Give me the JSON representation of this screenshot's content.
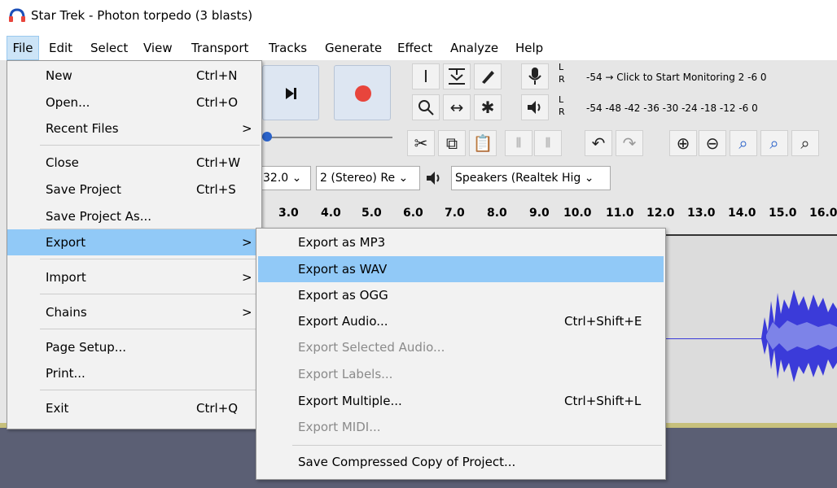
{
  "window": {
    "title": "Star Trek - Photon torpedo (3 blasts)"
  },
  "menubar": [
    {
      "label": "File"
    },
    {
      "label": "Edit"
    },
    {
      "label": "Select"
    },
    {
      "label": "View"
    },
    {
      "label": "Transport"
    },
    {
      "label": "Tracks"
    },
    {
      "label": "Generate"
    },
    {
      "label": "Effect"
    },
    {
      "label": "Analyze"
    },
    {
      "label": "Help"
    }
  ],
  "file_menu": [
    {
      "label": "New",
      "shortcut": "Ctrl+N"
    },
    {
      "label": "Open...",
      "shortcut": "Ctrl+O"
    },
    {
      "label": "Recent Files",
      "arrow": ">"
    },
    {
      "label": "Close",
      "shortcut": "Ctrl+W"
    },
    {
      "label": "Save Project",
      "shortcut": "Ctrl+S"
    },
    {
      "label": "Save Project As..."
    },
    {
      "label": "Export",
      "arrow": ">"
    },
    {
      "label": "Import",
      "arrow": ">"
    },
    {
      "label": "Chains",
      "arrow": ">"
    },
    {
      "label": "Page Setup..."
    },
    {
      "label": "Print..."
    },
    {
      "label": "Exit",
      "shortcut": "Ctrl+Q"
    }
  ],
  "export_menu": [
    {
      "label": "Export as MP3"
    },
    {
      "label": "Export as WAV"
    },
    {
      "label": "Export as OGG"
    },
    {
      "label": "Export Audio...",
      "shortcut": "Ctrl+Shift+E"
    },
    {
      "label": "Export Selected Audio..."
    },
    {
      "label": "Export Labels..."
    },
    {
      "label": "Export Multiple...",
      "shortcut": "Ctrl+Shift+L"
    },
    {
      "label": "Export MIDI..."
    },
    {
      "label": "Save Compressed Copy of Project..."
    }
  ],
  "meters": {
    "record_scale": "-54 → Click to Start Monitoring 2 -6 0",
    "play_scale": "-54 -48 -42 -36 -30 -24 -18 -12 -6 0",
    "L": "L",
    "R": "R"
  },
  "device_toolbar": {
    "rate": "32.0",
    "channels": "2 (Stereo) Re",
    "output": "Speakers (Realtek Hig"
  },
  "ruler_labels": [
    "3.0",
    "4.0",
    "5.0",
    "6.0",
    "7.0",
    "8.0",
    "9.0",
    "10.0",
    "11.0",
    "12.0",
    "13.0",
    "14.0",
    "15.0",
    "16.0"
  ],
  "colors": {
    "highlight": "#91c9f7",
    "record": "#e8453c",
    "waveform": "#3b3bd9"
  }
}
